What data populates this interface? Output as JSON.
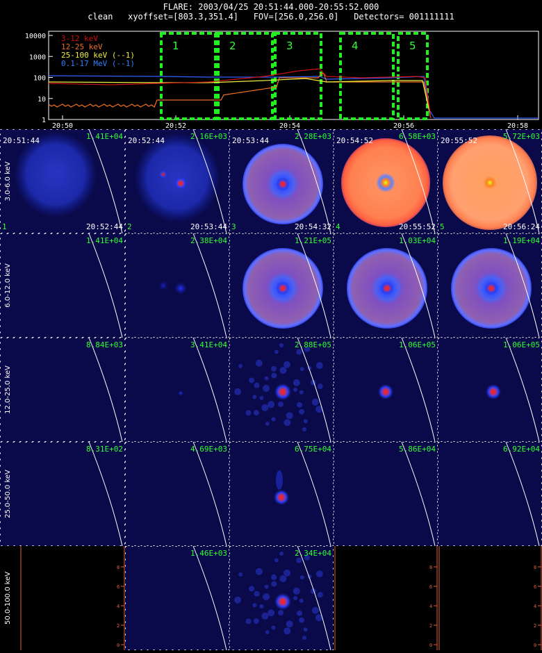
{
  "header": {
    "line1": "FLARE: 2003/04/25 20:51:44.000-20:55:52.000",
    "line2": "clean   xyoffset=[803.3,351.4]   FOV=[256.0,256.0]   Detectors= 001111111"
  },
  "lightcurve": {
    "yticks": [
      "10000",
      "1000",
      "100",
      "10",
      "1"
    ],
    "xticks": [
      "20:50",
      "20:52",
      "20:54",
      "20:56",
      "20:58"
    ],
    "legend": [
      {
        "text": "3-12 keV",
        "color": "#d01010"
      },
      {
        "text": "12-25 keV",
        "color": "#f07020"
      },
      {
        "text": "25-100 keV (--1)",
        "color": "#f0f040"
      },
      {
        "text": "0.1-17 MeV (--1)",
        "color": "#3080ff"
      }
    ],
    "intervals": [
      "1",
      "2",
      "3",
      "4",
      "5"
    ]
  },
  "images": {
    "row_labels": [
      "3.0-6.0 keV",
      "6.0-12.0 keV",
      "12.0-25.0 keV",
      "25.0-50.0 keV",
      "50.0-100.0 keV"
    ],
    "interval_numbers": [
      "1",
      "2",
      "3",
      "4",
      "5"
    ],
    "start_times": [
      "20:51:44",
      "20:52:44",
      "20:53:44",
      "20:54:52",
      "20:55:52"
    ],
    "end_times": [
      "20:52:44",
      "20:53:44",
      "20:54:32",
      "20:55:52",
      "20:56:24"
    ],
    "counts": [
      [
        "1.41E+04",
        "2.16E+03",
        "2.28E+03",
        "6.58E+03",
        "5.72E+03"
      ],
      [
        "1.41E+04",
        "2.38E+04",
        "1.21E+05",
        "1.03E+04",
        "1.19E+04"
      ],
      [
        "8.84E+03",
        "3.41E+04",
        "2.88E+05",
        "1.06E+05",
        "1.06E+05"
      ],
      [
        "8.31E+02",
        "4.69E+03",
        "6.75E+04",
        "5.86E+04",
        "6.92E+04"
      ],
      [
        "",
        "1.46E+03",
        "2.34E+04",
        "",
        ""
      ]
    ],
    "empty_axis_ticks": [
      "0",
      "2",
      "4",
      "6",
      "8"
    ]
  },
  "colors": {
    "background": "#000000",
    "panel_bg": "#0a0a4a",
    "grid_line": "#ffffff",
    "count_text": "#33ff33",
    "interval_box": "#22ee22",
    "empty_axis": "#e06040"
  }
}
